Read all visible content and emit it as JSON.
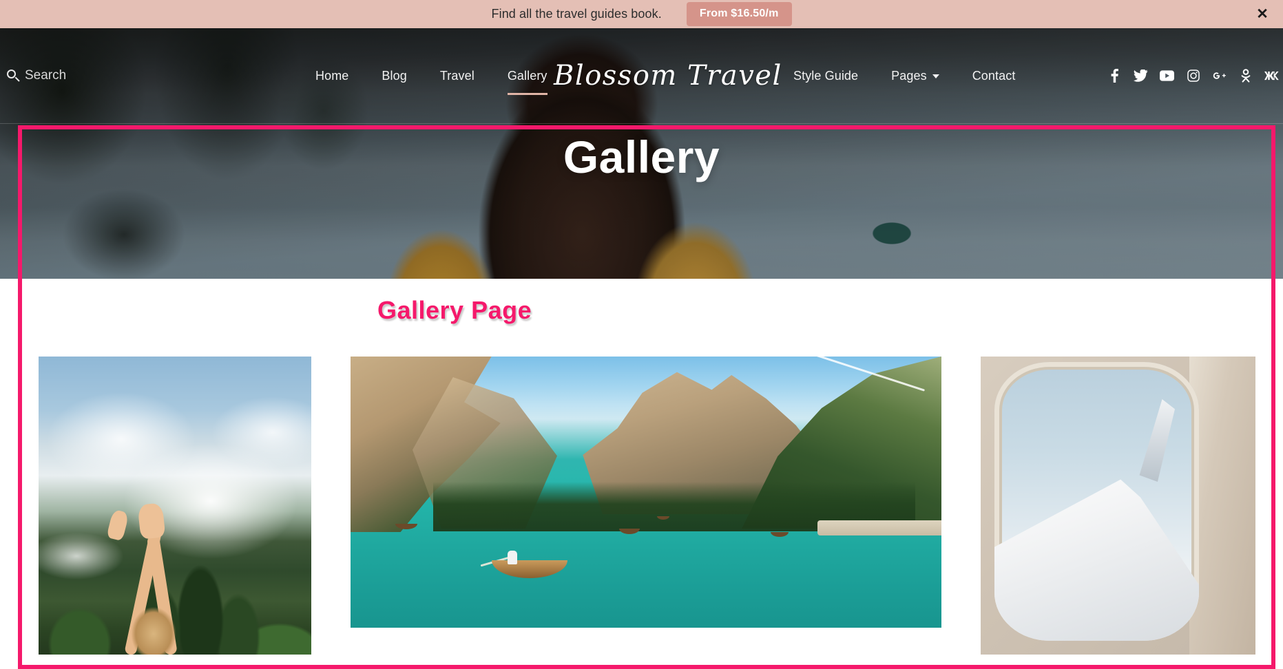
{
  "promo": {
    "text": "Find all the travel guides book.",
    "button_label": "From $16.50/m",
    "close_label": "✕",
    "bg_color": "#e4bfb5",
    "button_color": "#d5948a"
  },
  "navbar": {
    "search": {
      "label": "Search",
      "icon": "search-icon"
    },
    "brand": "Blossom Travel",
    "left_links": [
      {
        "label": "Home",
        "active": false
      },
      {
        "label": "Blog",
        "active": false
      },
      {
        "label": "Travel",
        "active": false
      },
      {
        "label": "Gallery",
        "active": true
      }
    ],
    "right_links": [
      {
        "label": "Style Guide",
        "has_caret": false
      },
      {
        "label": "Pages",
        "has_caret": true
      },
      {
        "label": "Contact",
        "has_caret": false
      }
    ],
    "social": [
      {
        "name": "facebook-icon",
        "label": "Facebook"
      },
      {
        "name": "twitter-icon",
        "label": "Twitter"
      },
      {
        "name": "youtube-icon",
        "label": "YouTube"
      },
      {
        "name": "instagram-icon",
        "label": "Instagram"
      },
      {
        "name": "googleplus-icon",
        "label": "Google Plus"
      },
      {
        "name": "odnoklassniki-icon",
        "label": "Odnoklassniki"
      },
      {
        "name": "vk-icon",
        "label": "VK"
      }
    ],
    "active_underline_color": "#e0b4a6"
  },
  "hero": {
    "title": "Gallery",
    "image_alt": "Woman in mustard sweater seen from behind looking over a lake"
  },
  "frame": {
    "border_color": "#f5196b",
    "border_width_px": 6
  },
  "main": {
    "section_heading": "Gallery Page",
    "heading_color": "#f5196b",
    "heading_outline_color": "#ffffff",
    "gallery": [
      {
        "name": "gallery-image-napali-cliffs",
        "alt": "Person with arms raised in front of green Na Pali coast cliffs and clouds",
        "column": "left"
      },
      {
        "name": "gallery-image-lago-di-braies",
        "alt": "Wooden rowboats on a turquoise alpine lake surrounded by dolomite peaks",
        "column": "center"
      },
      {
        "name": "gallery-image-airplane-window",
        "alt": "View of an airplane wing and winglet through a cabin window",
        "column": "right"
      }
    ]
  }
}
